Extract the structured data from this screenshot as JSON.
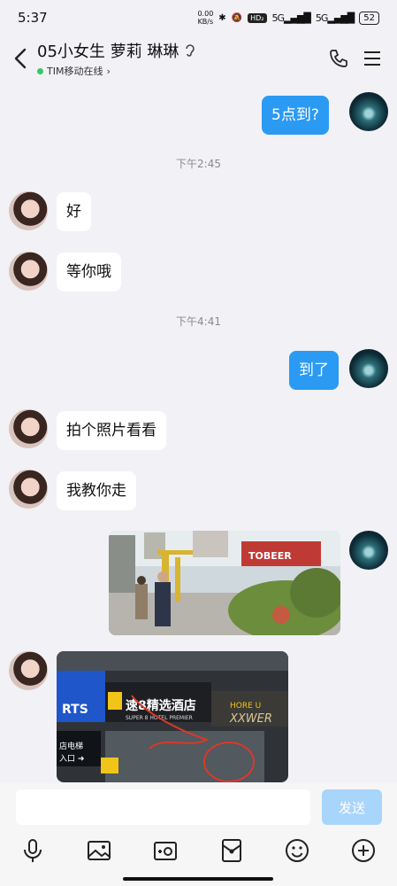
{
  "status": {
    "time": "5:37",
    "net_speed_top": "0.00",
    "net_speed_bottom": "KB/s",
    "hd": "HD₂",
    "signal1": "5G",
    "signal2": "5G",
    "battery": "52"
  },
  "header": {
    "title": "05小女生 萝莉 琳琳",
    "status_text": "TIM移动在线",
    "chevron": "›"
  },
  "messages": {
    "m1": "5点到?",
    "t1": "下午2:45",
    "m2": "好",
    "m3": "等你哦",
    "t2": "下午4:41",
    "m4": "到了",
    "m5": "拍个照片看看",
    "m6": "我教你走"
  },
  "photo2": {
    "sign1": "速8精选酒店",
    "sign1_sub": "SUPER 8 HOTEL PREMIER",
    "sign_left": "RTS",
    "sign_left2": "店电梯",
    "sign_left3": "入口 ➜",
    "sign_right": "HORE U",
    "sign_right2": "XXWER"
  },
  "photo1": {
    "sign": "TOBEER"
  },
  "input": {
    "placeholder": "",
    "send_label": "发送"
  },
  "colors": {
    "accent": "#2b9af3",
    "send_disabled": "#a8d5fb",
    "online": "#37c86a"
  }
}
